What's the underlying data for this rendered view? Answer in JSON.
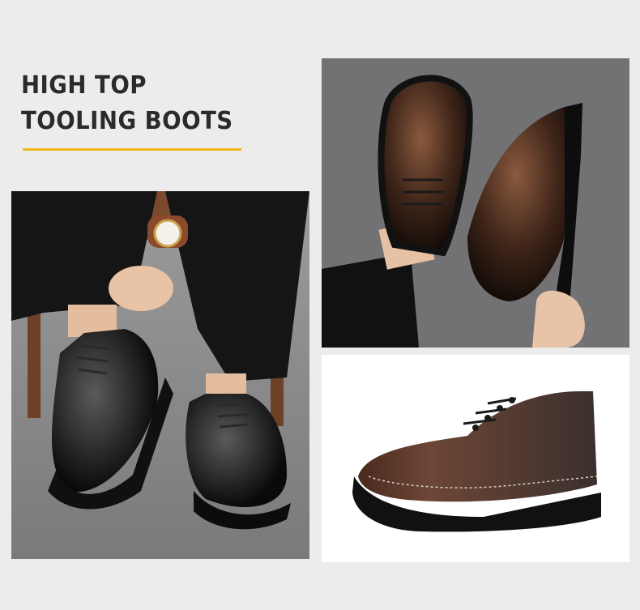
{
  "heading": {
    "line1": "HIGH TOP",
    "line2": "TOOLING BOOTS"
  },
  "colors": {
    "accent_rule": "#f0b71b",
    "page_background": "#ececec",
    "heading_text": "#2b2b2b"
  },
  "images": [
    {
      "subject": "seated man tying black leather derby shoes with chunky lug soles, wearing a wristwatch"
    },
    {
      "subject": "model wearing brown polished lace-up shoe, hand holding a second shoe"
    },
    {
      "subject": "single dark brown burnished derby shoe with thick lug sole on white background"
    }
  ]
}
